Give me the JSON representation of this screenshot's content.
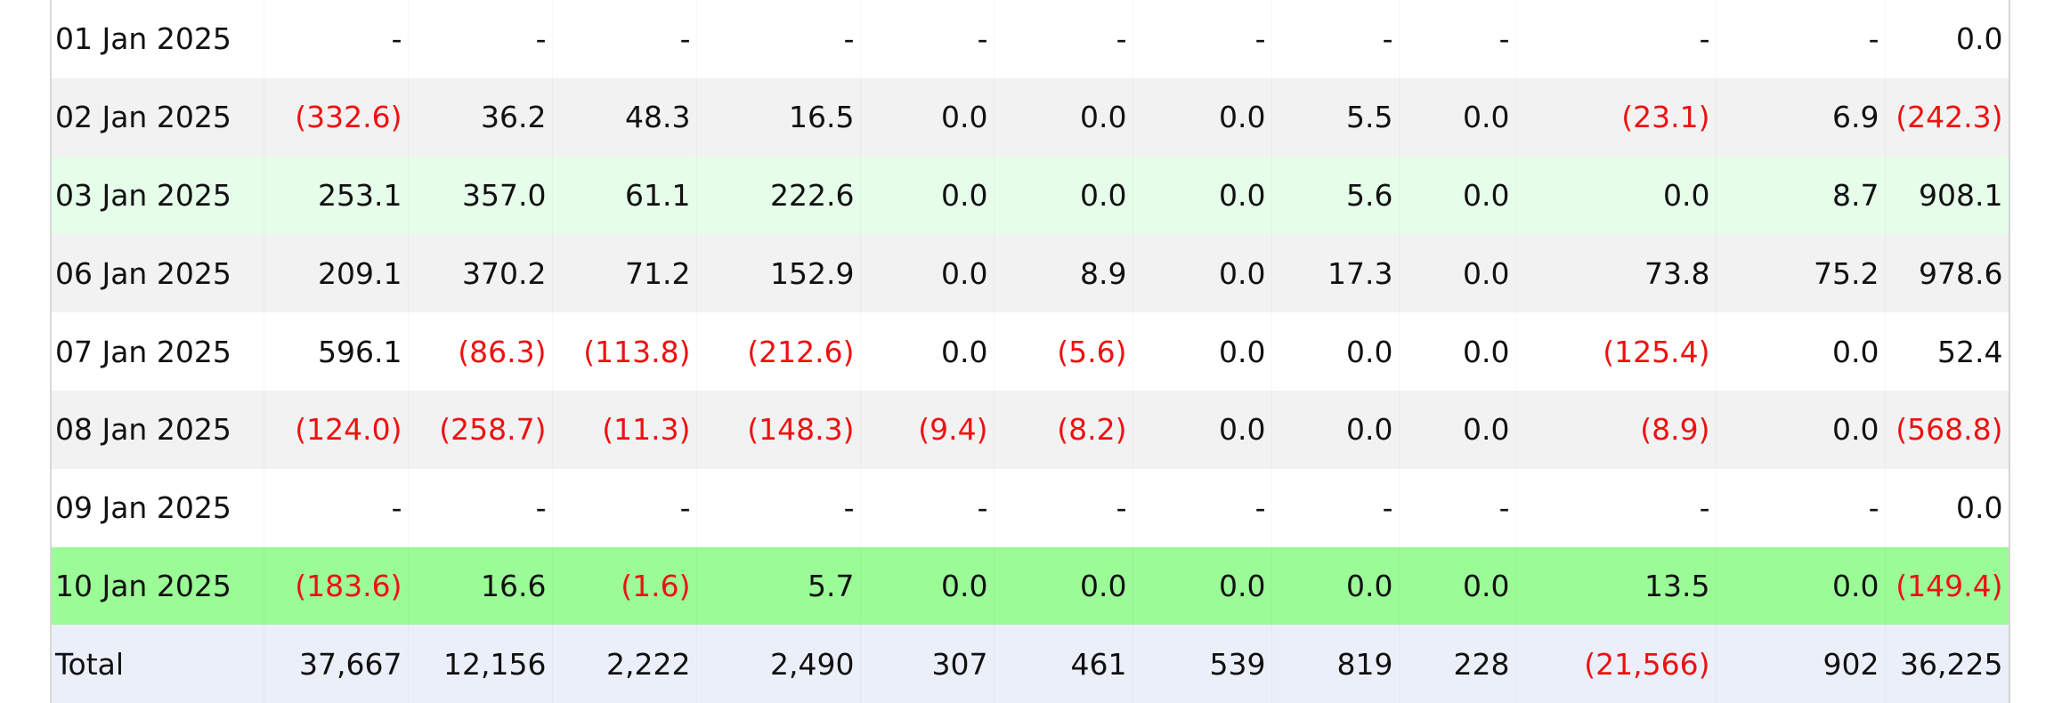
{
  "table": {
    "rows": [
      {
        "style": "white",
        "date": "01 Jan 2025",
        "cells": [
          "-",
          "-",
          "-",
          "-",
          "-",
          "-",
          "-",
          "-",
          "-",
          "-",
          "-",
          "0.0"
        ]
      },
      {
        "style": "grey",
        "date": "02 Jan 2025",
        "cells": [
          "(332.6)",
          "36.2",
          "48.3",
          "16.5",
          "0.0",
          "0.0",
          "0.0",
          "5.5",
          "0.0",
          "(23.1)",
          "6.9",
          "(242.3)"
        ]
      },
      {
        "style": "mint",
        "date": "03 Jan 2025",
        "cells": [
          "253.1",
          "357.0",
          "61.1",
          "222.6",
          "0.0",
          "0.0",
          "0.0",
          "5.6",
          "0.0",
          "0.0",
          "8.7",
          "908.1"
        ]
      },
      {
        "style": "grey",
        "date": "06 Jan 2025",
        "cells": [
          "209.1",
          "370.2",
          "71.2",
          "152.9",
          "0.0",
          "8.9",
          "0.0",
          "17.3",
          "0.0",
          "73.8",
          "75.2",
          "978.6"
        ]
      },
      {
        "style": "white",
        "date": "07 Jan 2025",
        "cells": [
          "596.1",
          "(86.3)",
          "(113.8)",
          "(212.6)",
          "0.0",
          "(5.6)",
          "0.0",
          "0.0",
          "0.0",
          "(125.4)",
          "0.0",
          "52.4"
        ]
      },
      {
        "style": "grey",
        "date": "08 Jan 2025",
        "cells": [
          "(124.0)",
          "(258.7)",
          "(11.3)",
          "(148.3)",
          "(9.4)",
          "(8.2)",
          "0.0",
          "0.0",
          "0.0",
          "(8.9)",
          "0.0",
          "(568.8)"
        ]
      },
      {
        "style": "white",
        "date": "09 Jan 2025",
        "cells": [
          "-",
          "-",
          "-",
          "-",
          "-",
          "-",
          "-",
          "-",
          "-",
          "-",
          "-",
          "0.0"
        ]
      },
      {
        "style": "green",
        "date": "10 Jan 2025",
        "cells": [
          "(183.6)",
          "16.6",
          "(1.6)",
          "5.7",
          "0.0",
          "0.0",
          "0.0",
          "0.0",
          "0.0",
          "13.5",
          "0.0",
          "(149.4)"
        ]
      },
      {
        "style": "total",
        "date": "Total",
        "cells": [
          "37,667",
          "12,156",
          "2,222",
          "2,490",
          "307",
          "461",
          "539",
          "819",
          "228",
          "(21,566)",
          "902",
          "36,225"
        ]
      }
    ]
  },
  "colors": {
    "negative": "#ee1111",
    "row_grey": "#f2f2f2",
    "row_mint": "#e6fdea",
    "row_green": "#9bfb97",
    "row_total": "#eaeff9"
  }
}
